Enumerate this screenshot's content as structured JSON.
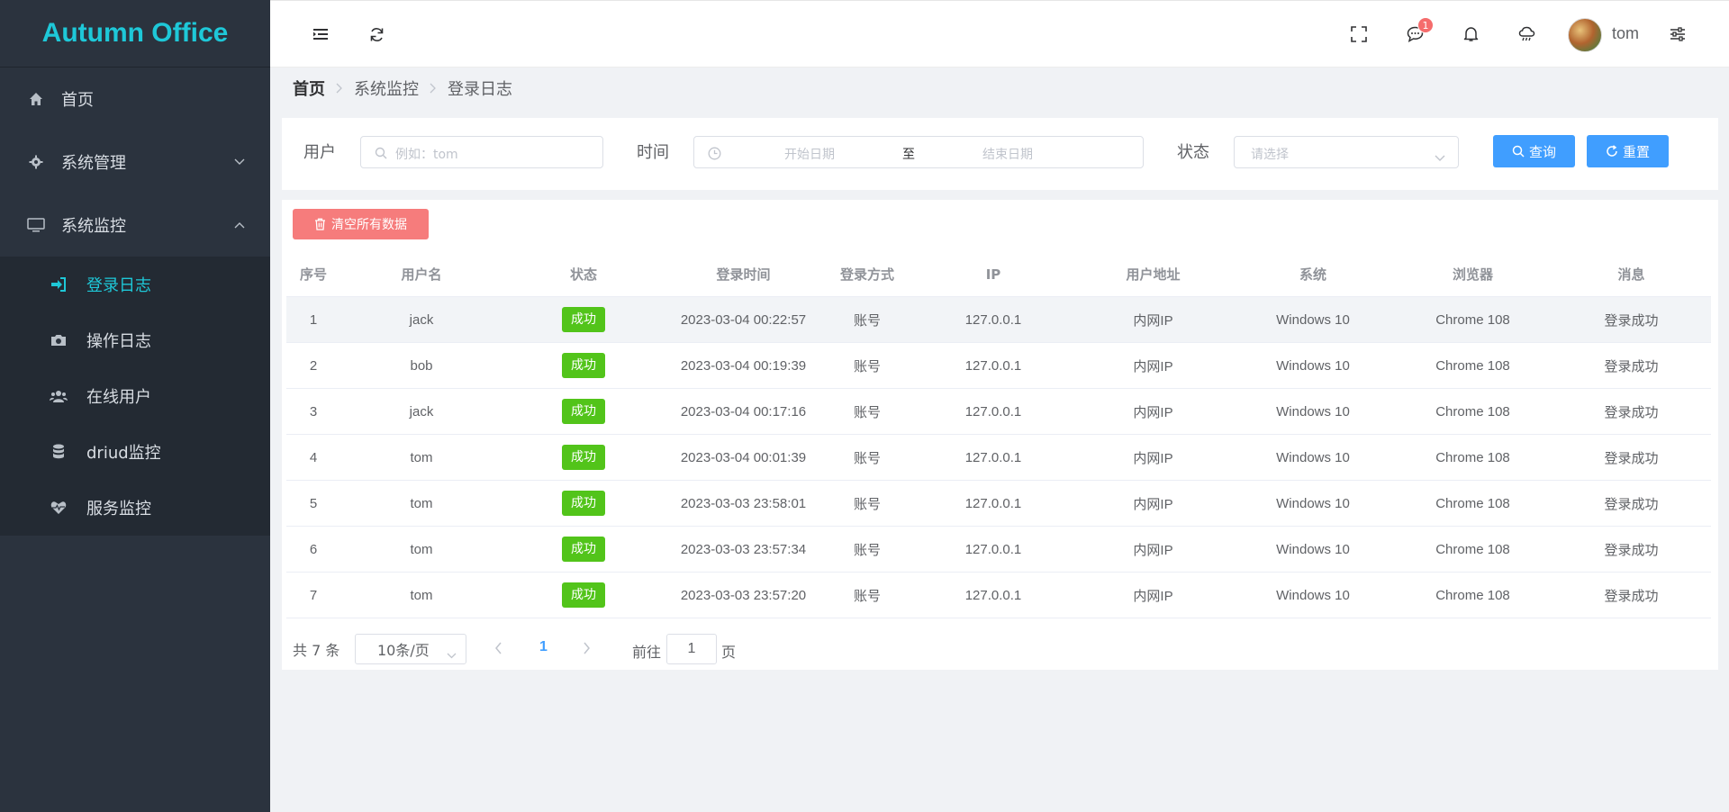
{
  "app": {
    "brand": "Autumn Office"
  },
  "sidebar": {
    "items": [
      {
        "label": "首页",
        "icon": "home-icon"
      },
      {
        "label": "系统管理",
        "icon": "gear-icon",
        "expanded": false
      },
      {
        "label": "系统监控",
        "icon": "monitor-icon",
        "expanded": true
      }
    ],
    "monitor_subitems": [
      {
        "label": "登录日志",
        "icon": "sign-in-icon",
        "active": true
      },
      {
        "label": "操作日志",
        "icon": "camera-icon",
        "active": false
      },
      {
        "label": "在线用户",
        "icon": "users-icon",
        "active": false
      },
      {
        "label": "driud监控",
        "icon": "database-icon",
        "active": false
      },
      {
        "label": "服务监控",
        "icon": "heartbeat-icon",
        "active": false
      }
    ]
  },
  "header": {
    "message_badge": "1",
    "username": "tom"
  },
  "breadcrumb": [
    "首页",
    "系统监控",
    "登录日志"
  ],
  "search": {
    "user_label": "用户",
    "user_placeholder": "例如：tom",
    "time_label": "时间",
    "start_placeholder": "开始日期",
    "range_separator": "至",
    "end_placeholder": "结束日期",
    "status_label": "状态",
    "status_placeholder": "请选择",
    "query_label": "查询",
    "reset_label": "重置"
  },
  "toolbar": {
    "clear_label": "清空所有数据"
  },
  "table": {
    "columns": [
      "序号",
      "用户名",
      "状态",
      "登录时间",
      "登录方式",
      "IP",
      "用户地址",
      "系统",
      "浏览器",
      "消息"
    ],
    "rows": [
      [
        "1",
        "jack",
        "成功",
        "2023-03-04 00:22:57",
        "账号",
        "127.0.0.1",
        "内网IP",
        "Windows 10",
        "Chrome 108",
        "登录成功"
      ],
      [
        "2",
        "bob",
        "成功",
        "2023-03-04 00:19:39",
        "账号",
        "127.0.0.1",
        "内网IP",
        "Windows 10",
        "Chrome 108",
        "登录成功"
      ],
      [
        "3",
        "jack",
        "成功",
        "2023-03-04 00:17:16",
        "账号",
        "127.0.0.1",
        "内网IP",
        "Windows 10",
        "Chrome 108",
        "登录成功"
      ],
      [
        "4",
        "tom",
        "成功",
        "2023-03-04 00:01:39",
        "账号",
        "127.0.0.1",
        "内网IP",
        "Windows 10",
        "Chrome 108",
        "登录成功"
      ],
      [
        "5",
        "tom",
        "成功",
        "2023-03-03 23:58:01",
        "账号",
        "127.0.0.1",
        "内网IP",
        "Windows 10",
        "Chrome 108",
        "登录成功"
      ],
      [
        "6",
        "tom",
        "成功",
        "2023-03-03 23:57:34",
        "账号",
        "127.0.0.1",
        "内网IP",
        "Windows 10",
        "Chrome 108",
        "登录成功"
      ],
      [
        "7",
        "tom",
        "成功",
        "2023-03-03 23:57:20",
        "账号",
        "127.0.0.1",
        "内网IP",
        "Windows 10",
        "Chrome 108",
        "登录成功"
      ]
    ]
  },
  "pagination": {
    "total_text": "共 7 条",
    "page_size": "10条/页",
    "current_page": "1",
    "goto_label": "前往",
    "goto_value": "1",
    "page_suffix": "页"
  },
  "colors": {
    "sidebar_bg": "#2b333e",
    "accent": "#1ec8d8",
    "primary": "#409eff",
    "danger": "#f67c7c",
    "success": "#52c41a"
  }
}
